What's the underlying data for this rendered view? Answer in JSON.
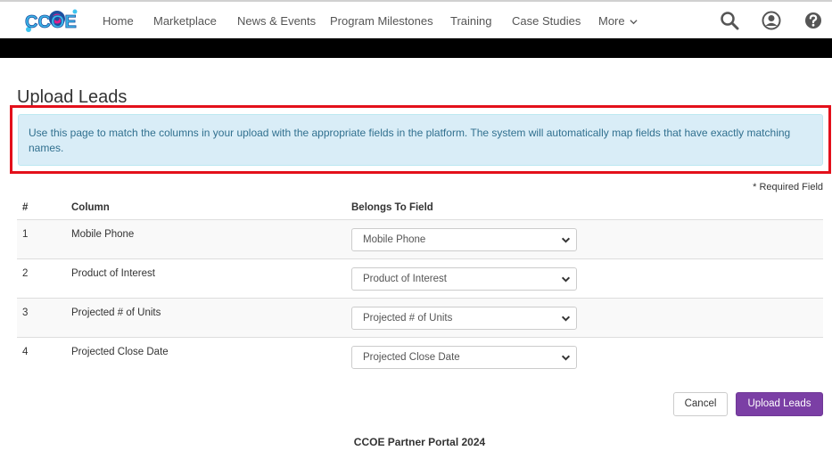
{
  "nav": {
    "logo_text": "CCOE",
    "items": [
      {
        "label": "Home"
      },
      {
        "label": "Marketplace"
      },
      {
        "label": "News & Events"
      },
      {
        "label": "Program Milestones"
      },
      {
        "label": "Training"
      },
      {
        "label": "Case Studies"
      },
      {
        "label": "More"
      }
    ]
  },
  "page": {
    "title": "Upload Leads",
    "info": "Use this page to match the columns in your upload with the appropriate fields in the platform. The system will automatically map fields that have exactly matching names.",
    "required_note": "* Required Field"
  },
  "table": {
    "headers": {
      "num": "#",
      "column": "Column",
      "field": "Belongs To Field"
    },
    "rows": [
      {
        "num": "1",
        "column": "Mobile Phone",
        "field": "Mobile Phone"
      },
      {
        "num": "2",
        "column": "Product of Interest",
        "field": "Product of Interest"
      },
      {
        "num": "3",
        "column": "Projected # of Units",
        "field": "Projected # of Units"
      },
      {
        "num": "4",
        "column": "Projected Close Date",
        "field": "Projected Close Date"
      }
    ]
  },
  "actions": {
    "cancel": "Cancel",
    "upload": "Upload Leads"
  },
  "footer": {
    "text": "CCOE Partner Portal 2024"
  },
  "colors": {
    "accent": "#7b3fa5",
    "highlight": "#e3101b",
    "info_bg": "#d9edf7",
    "info_text": "#31708f"
  }
}
